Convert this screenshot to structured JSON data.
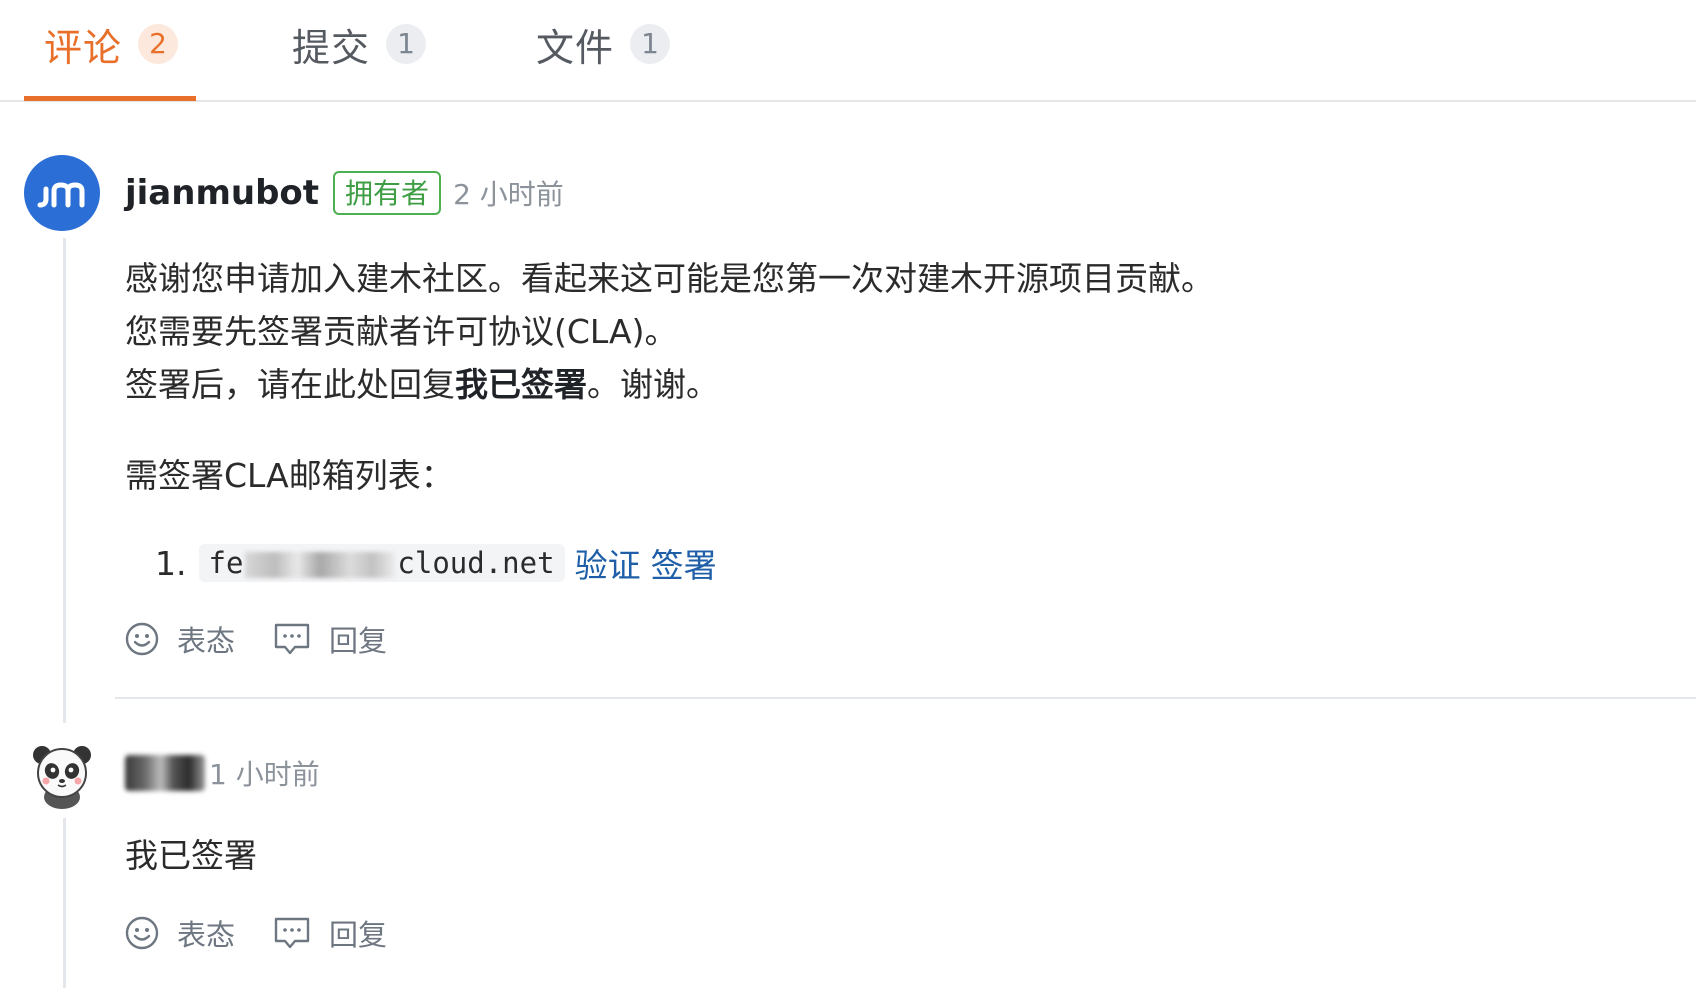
{
  "tabs": [
    {
      "label": "评论",
      "count": "2",
      "active": true
    },
    {
      "label": "提交",
      "count": "1",
      "active": false
    },
    {
      "label": "文件",
      "count": "1",
      "active": false
    }
  ],
  "comments": [
    {
      "author": "jianmubot",
      "role": "拥有者",
      "time": "2 小时前",
      "avatar_icon": "jianmu-logo",
      "body": {
        "line1": "感谢您申请加入建木社区。看起来这可能是您第一次对建木开源项目贡献。",
        "line2": "您需要先签署贡献者许可协议(CLA)。",
        "line3_before": "签署后，请在此处回复",
        "line3_bold": "我已签署",
        "line3_after": "。谢谢。",
        "list_title": "需签署CLA邮箱列表：",
        "email_index": "1.",
        "email_prefix": "fe",
        "email_suffix": "cloud.net",
        "verify_link": "验证",
        "sign_link": "签署"
      },
      "actions": {
        "react_label": "表态",
        "reply_label": "回复"
      }
    },
    {
      "author": "",
      "time": "1 小时前",
      "avatar_icon": "panda-avatar",
      "body": {
        "text": "我已签署"
      },
      "actions": {
        "react_label": "表态",
        "reply_label": "回复"
      }
    }
  ],
  "colors": {
    "accent": "#e8702a",
    "owner_badge": "#4caf50",
    "link": "#1f5fa8",
    "avatar_bg": "#2b6fd6"
  }
}
